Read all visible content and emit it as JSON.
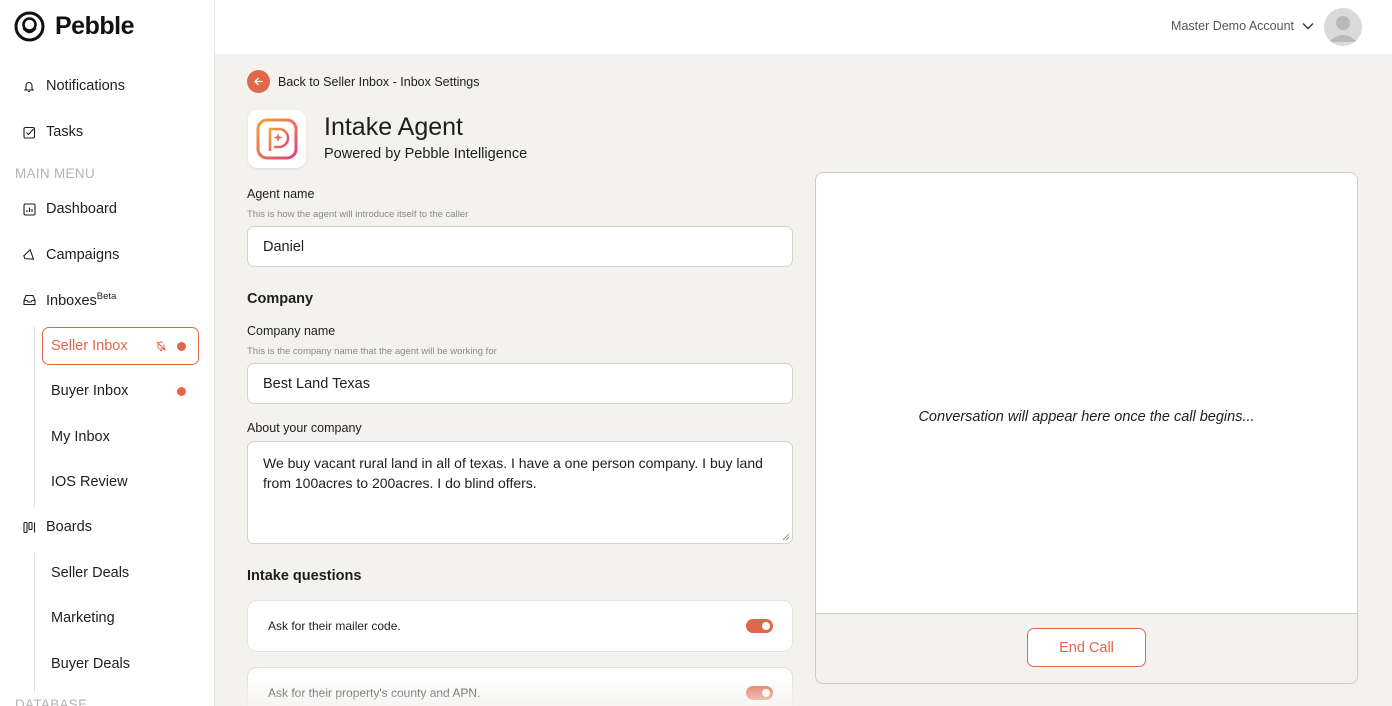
{
  "app": {
    "name": "Pebble",
    "logo_icon": "pebble-logo-icon"
  },
  "sidebar": {
    "items_top": [
      {
        "label": "Notifications",
        "icon": "bell-icon"
      },
      {
        "label": "Tasks",
        "icon": "checkbox-icon"
      }
    ],
    "main_menu_label": "MAIN MENU",
    "main": [
      {
        "label": "Dashboard",
        "icon": "chart-icon"
      },
      {
        "label": "Campaigns",
        "icon": "megaphone-icon"
      },
      {
        "label": "Inboxes",
        "badge": "Beta",
        "icon": "inbox-icon"
      }
    ],
    "inboxes": [
      {
        "label": "Seller Inbox",
        "active": true,
        "muted": true,
        "unread": true
      },
      {
        "label": "Buyer Inbox",
        "unread": true
      },
      {
        "label": "My Inbox"
      },
      {
        "label": "IOS Review"
      }
    ],
    "boards_label": "Boards",
    "boards_icon": "kanban-icon",
    "boards": [
      {
        "label": "Seller Deals"
      },
      {
        "label": "Marketing"
      },
      {
        "label": "Buyer Deals"
      }
    ],
    "database_label": "DATABASE"
  },
  "header": {
    "account_name": "Master Demo Account",
    "account_icon": "chevron-down-icon",
    "avatar": "user-avatar-icon"
  },
  "page": {
    "back_label": "Back to Seller Inbox - Inbox Settings",
    "title": "Intake Agent",
    "subtitle": "Powered by Pebble Intelligence"
  },
  "form": {
    "agent_name_label": "Agent name",
    "agent_name_help": "This is how the agent will introduce itself to the caller",
    "agent_name_value": "Daniel",
    "company_heading": "Company",
    "company_name_label": "Company name",
    "company_name_help": "This is the company name that the agent will be working for",
    "company_name_value": "Best Land Texas",
    "about_label": "About your company",
    "about_value": "We buy vacant rural land in all of texas. I have a one person company. I buy land from 100acres to 200acres. I do blind offers.",
    "questions_heading": "Intake questions",
    "questions": [
      {
        "text": "Ask for their mailer code.",
        "enabled": true
      },
      {
        "text": "Ask for their property's county and APN.",
        "enabled": true
      }
    ]
  },
  "conversation": {
    "placeholder": "Conversation will appear here once the call begins...",
    "end_call_label": "End Call"
  },
  "colors": {
    "accent": "#e0674a",
    "background": "#f4f2ef"
  }
}
